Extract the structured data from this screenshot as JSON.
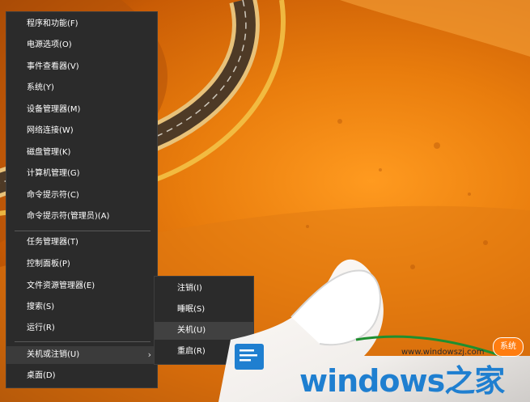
{
  "menu": {
    "items": [
      {
        "label": "程序和功能(F)"
      },
      {
        "label": "电源选项(O)"
      },
      {
        "label": "事件查看器(V)"
      },
      {
        "label": "系统(Y)"
      },
      {
        "label": "设备管理器(M)"
      },
      {
        "label": "网络连接(W)"
      },
      {
        "label": "磁盘管理(K)"
      },
      {
        "label": "计算机管理(G)"
      },
      {
        "label": "命令提示符(C)"
      },
      {
        "label": "命令提示符(管理员)(A)"
      },
      {
        "label": "任务管理器(T)"
      },
      {
        "label": "控制面板(P)"
      },
      {
        "label": "文件资源管理器(E)"
      },
      {
        "label": "搜索(S)"
      },
      {
        "label": "运行(R)"
      },
      {
        "label": "关机或注销(U)",
        "chevron": "›"
      },
      {
        "label": "桌面(D)"
      }
    ]
  },
  "submenu": {
    "items": [
      {
        "label": "注销(I)"
      },
      {
        "label": "睡眠(S)"
      },
      {
        "label": "关机(U)"
      },
      {
        "label": "重启(R)"
      }
    ]
  },
  "watermark": {
    "url": "www.windowszj.com",
    "brand": "windows之家",
    "badge": "系统"
  },
  "colors": {
    "menu_bg": "#2b2b2b",
    "accent_blue": "#1f7fd0",
    "badge_orange": "#ff7d10"
  }
}
